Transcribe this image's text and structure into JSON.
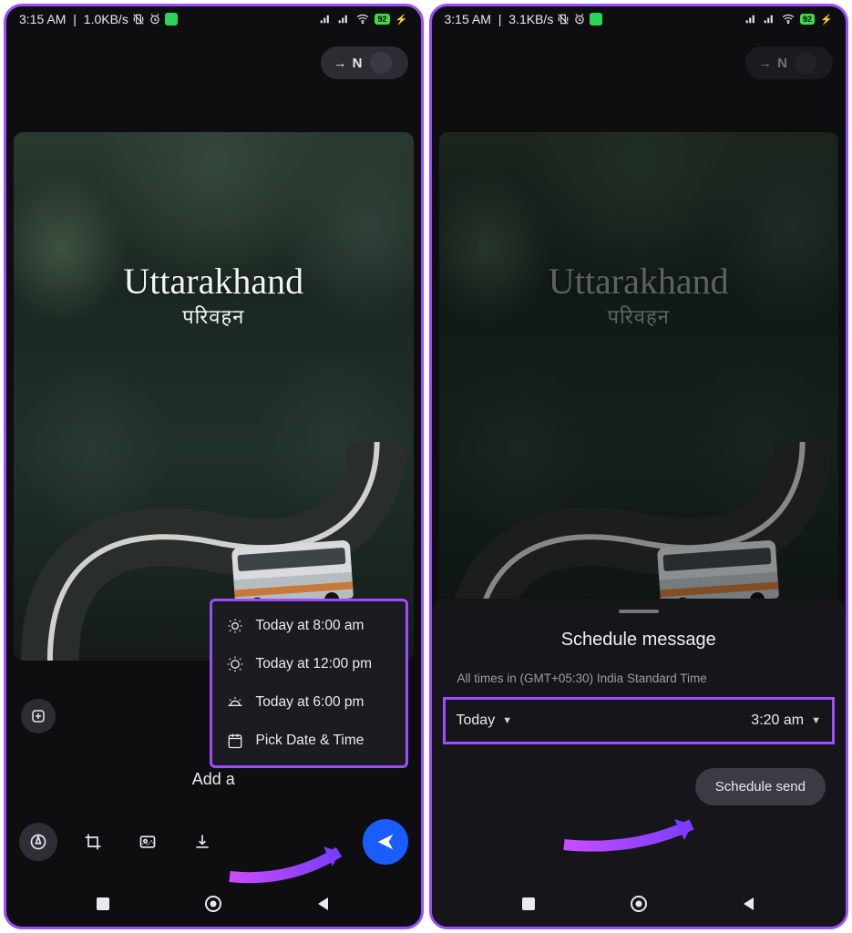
{
  "left": {
    "status": {
      "time": "3:15 AM",
      "net": "1.0KB/s",
      "battery": "92"
    },
    "recipient": "N",
    "photo": {
      "title": "Uttarakhand",
      "subtitle": "परिवहन"
    },
    "caption_placeholder": "Add a",
    "popup": {
      "items": [
        {
          "icon": "sunrise-icon",
          "label": "Today at 8:00 am"
        },
        {
          "icon": "sun-icon",
          "label": "Today at 12:00 pm"
        },
        {
          "icon": "sunset-icon",
          "label": "Today at 6:00 pm"
        },
        {
          "icon": "calendar-icon",
          "label": "Pick Date & Time"
        }
      ]
    }
  },
  "right": {
    "status": {
      "time": "3:15 AM",
      "net": "3.1KB/s",
      "battery": "92"
    },
    "recipient": "N",
    "photo": {
      "title": "Uttarakhand",
      "subtitle": "परिवहन"
    },
    "sheet": {
      "title": "Schedule message",
      "tz_text": "All times in (GMT+05:30) India Standard Time",
      "date_value": "Today",
      "time_value": "3:20 am",
      "button": "Schedule send"
    }
  },
  "colors": {
    "highlight": "#9b4dff",
    "send": "#1a5dff"
  }
}
